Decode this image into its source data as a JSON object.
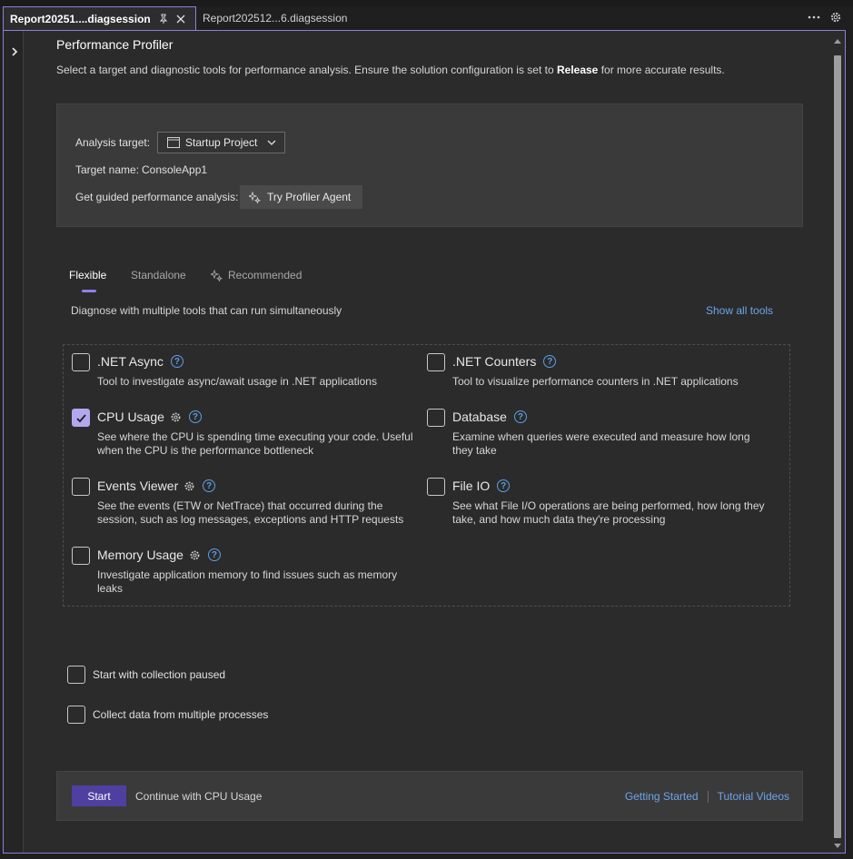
{
  "tabs": {
    "active_title": "Report20251....diagsession",
    "inactive_title": "Report202512...6.diagsession"
  },
  "page": {
    "title": "Performance Profiler",
    "description_prefix": "Select a target and diagnostic tools for performance analysis.  Ensure the solution configuration is set to ",
    "description_bold": "Release",
    "description_suffix": " for more accurate results."
  },
  "target": {
    "analysis_label": "Analysis target:",
    "analysis_value": "Startup Project",
    "name_label": "Target name:",
    "name_value": "ConsoleApp1",
    "guided_label": "Get guided performance analysis:",
    "agent_button": "Try Profiler Agent"
  },
  "mode_tabs": [
    {
      "label": "Flexible",
      "active": true
    },
    {
      "label": "Standalone",
      "active": false
    },
    {
      "label": "Recommended",
      "active": false
    }
  ],
  "tools_description": "Diagnose with multiple tools that can run simultaneously",
  "show_all_tools": "Show all tools",
  "tools": [
    {
      "name": ".NET Async",
      "checked": false,
      "has_gear": false,
      "description": "Tool to investigate async/await usage in .NET applications"
    },
    {
      "name": ".NET Counters",
      "checked": false,
      "has_gear": false,
      "description": "Tool to visualize performance counters in .NET applications"
    },
    {
      "name": "CPU Usage",
      "checked": true,
      "has_gear": true,
      "description": "See where the CPU is spending time executing your code. Useful when the CPU is the performance bottleneck"
    },
    {
      "name": "Database",
      "checked": false,
      "has_gear": false,
      "description": "Examine when queries were executed and measure how long they take"
    },
    {
      "name": "Events Viewer",
      "checked": false,
      "has_gear": true,
      "description": "See the events (ETW or NetTrace) that occurred during the session, such as log messages, exceptions and HTTP requests"
    },
    {
      "name": "File IO",
      "checked": false,
      "has_gear": false,
      "description": "See what File I/O operations are being performed, how long they take, and how much data they're processing"
    },
    {
      "name": "Memory Usage",
      "checked": false,
      "has_gear": true,
      "description": "Investigate application memory to find issues such as memory leaks"
    }
  ],
  "options": {
    "paused": "Start with collection paused",
    "multi_process": "Collect data from multiple processes"
  },
  "footer": {
    "start": "Start",
    "continue_text": "Continue with CPU Usage",
    "getting_started": "Getting Started",
    "tutorial_videos": "Tutorial Videos"
  },
  "colors": {
    "accent": "#8b7fd6",
    "checked": "#b3a7ef",
    "start_button": "#4f3fa0",
    "link": "#6ba6e8",
    "help_icon": "#5aa0e6"
  }
}
